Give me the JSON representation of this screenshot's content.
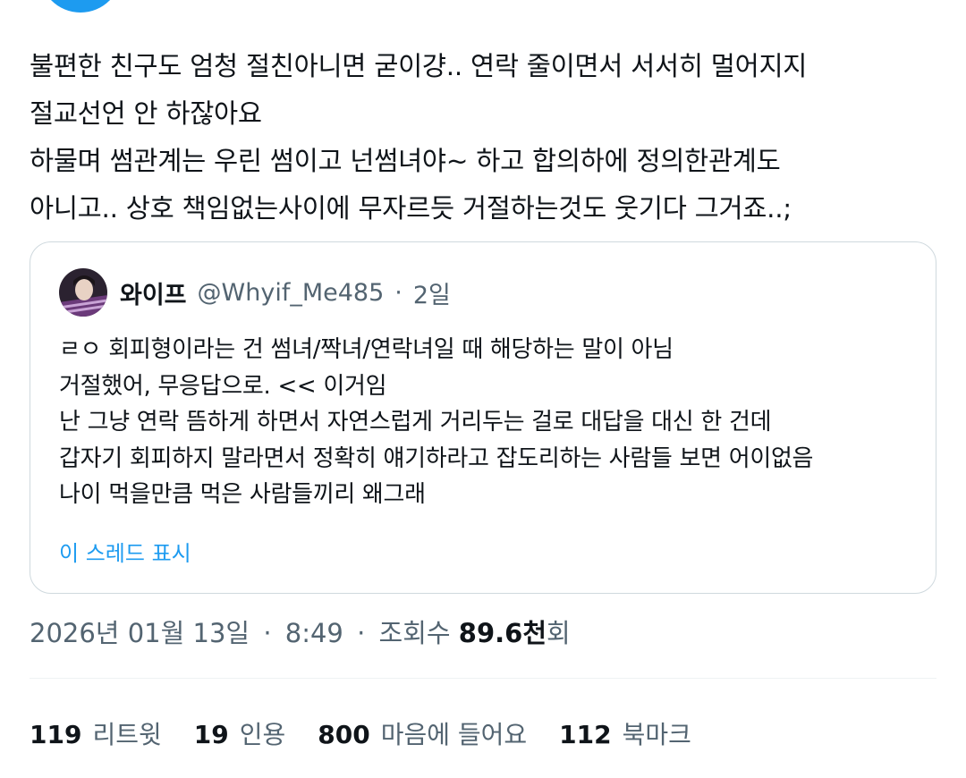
{
  "tweet": {
    "lines": [
      "불편한 친구도 엄청 절친아니면 굳이걍.. 연락 줄이면서 서서히 멀어지지",
      "절교선언 안 하잖아요",
      "하물며 썸관계는 우린 썸이고 넌썸녀야~ 하고 합의하에 정의한관계도",
      "아니고.. 상호 책임없는사이에 무자르듯 거절하는것도 웃기다 그거죠..;"
    ]
  },
  "quote": {
    "name": "와이프",
    "handle": "@Whyif_Me485",
    "separator": "·",
    "time": "2일",
    "lines": [
      "ㄹㅇ 회피형이라는 건 썸녀/짝녀/연락녀일 때 해당하는 말이 아님",
      "거절했어, 무응답으로. << 이거임",
      "난 그냥 연락 뜸하게 하면서 자연스럽게 거리두는 걸로 대답을 대신 한 건데",
      "갑자기 회피하지 말라면서 정확히 얘기하라고 잡도리하는 사람들 보면 어이없음",
      "나이 먹을만큼 먹은 사람들끼리 왜그래"
    ],
    "show_thread": "이 스레드 표시"
  },
  "meta": {
    "date": "2026년 01월 13일",
    "separator": "·",
    "time": "8:49",
    "views_label": "조회수",
    "views_count": "89.6천",
    "views_suffix": "회"
  },
  "stats": {
    "retweets": {
      "count": "119",
      "label": "리트윗"
    },
    "quotes": {
      "count": "19",
      "label": "인용"
    },
    "likes": {
      "count": "800",
      "label": "마음에 들어요"
    },
    "bookmarks": {
      "count": "112",
      "label": "북마크"
    }
  },
  "colors": {
    "text": "#0f1419",
    "secondary": "#536471",
    "accent": "#1d9bf0",
    "border": "#cfd9de"
  }
}
